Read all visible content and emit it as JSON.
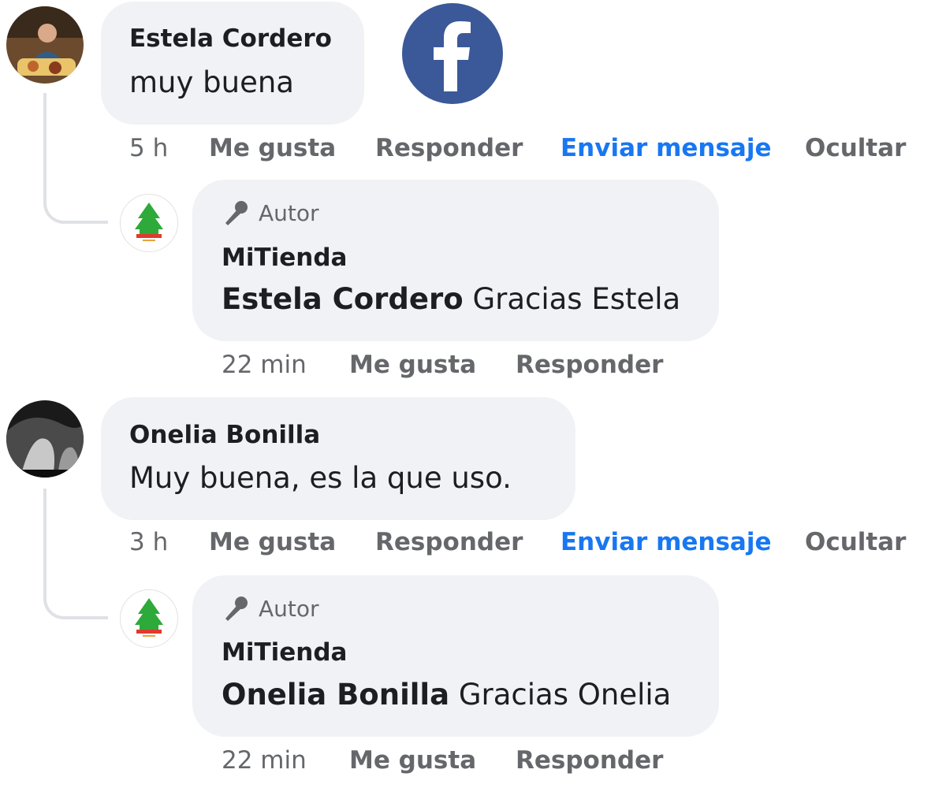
{
  "brand": {
    "logo_icon": "facebook-logo-icon",
    "logo_color": "#3b5998"
  },
  "colors": {
    "bubble": "#f0f2f5",
    "link_blue": "#1877f2",
    "muted": "#65676b",
    "text": "#1c1e21"
  },
  "comments": [
    {
      "author": "Estela Cordero",
      "text": "muy buena",
      "time": "5 h",
      "actions": {
        "like": "Me gusta",
        "reply": "Responder",
        "message": "Enviar mensaje",
        "hide": "Ocultar"
      },
      "reply": {
        "badge": "Autor",
        "page": "MiTienda",
        "mention": "Estela Cordero",
        "text": " Gracias Estela",
        "time": "22 min",
        "actions": {
          "like": "Me gusta",
          "reply": "Responder"
        }
      }
    },
    {
      "author": "Onelia Bonilla",
      "text": "Muy buena, es la que uso.",
      "time": "3 h",
      "actions": {
        "like": "Me gusta",
        "reply": "Responder",
        "message": "Enviar mensaje",
        "hide": "Ocultar"
      },
      "reply": {
        "badge": "Autor",
        "page": "MiTienda",
        "mention": "Onelia Bonilla",
        "text": " Gracias Onelia",
        "time": "22 min",
        "actions": {
          "like": "Me gusta",
          "reply": "Responder"
        }
      }
    }
  ]
}
